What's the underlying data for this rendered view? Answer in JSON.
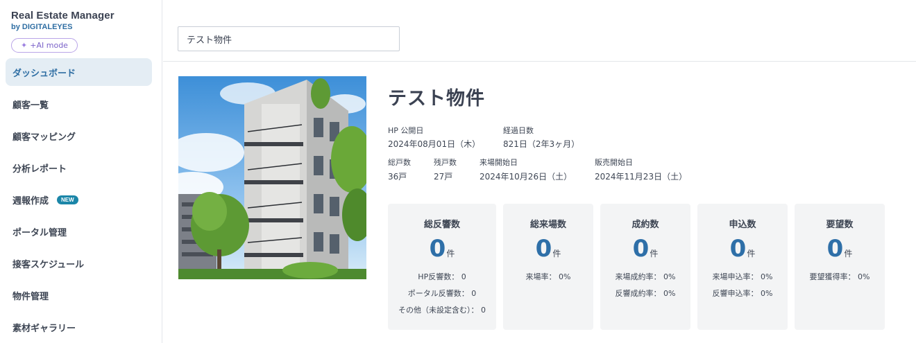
{
  "sidebar": {
    "brand_title": "Real Estate Manager",
    "brand_sub": "by DIGITALEYES",
    "ai_mode": "+AI mode",
    "items": [
      {
        "label": "ダッシュボード",
        "active": true
      },
      {
        "label": "顧客一覧"
      },
      {
        "label": "顧客マッピング"
      },
      {
        "label": "分析レポート"
      },
      {
        "label": "週報作成",
        "badge": "NEW"
      },
      {
        "label": "ポータル管理"
      },
      {
        "label": "接客スケジュール"
      },
      {
        "label": "物件管理"
      },
      {
        "label": "素材ギャラリー"
      }
    ]
  },
  "header": {
    "property_select_value": "テスト物件"
  },
  "property": {
    "title": "テスト物件",
    "hp_published_label": "HP 公開日",
    "hp_published_value": "2024年08月01日（木）",
    "elapsed_label": "経過日数",
    "elapsed_value": "821日（2年3ヶ月）",
    "total_units_label": "総戸数",
    "total_units_value": "36戸",
    "remaining_units_label": "残戸数",
    "remaining_units_value": "27戸",
    "visit_start_label": "来場開始日",
    "visit_start_value": "2024年10月26日（土）",
    "sales_start_label": "販売開始日",
    "sales_start_value": "2024年11月23日（土）"
  },
  "stats": [
    {
      "title": "総反響数",
      "count": "0",
      "unit": "件",
      "lines": [
        "HP反響数： 0",
        "ポータル反響数： 0",
        "その他（未設定含む）： 0"
      ]
    },
    {
      "title": "総来場数",
      "count": "0",
      "unit": "件",
      "lines": [
        "来場率： 0%"
      ]
    },
    {
      "title": "成約数",
      "count": "0",
      "unit": "件",
      "lines": [
        "来場成約率： 0%",
        "反響成約率： 0%"
      ]
    },
    {
      "title": "申込数",
      "count": "0",
      "unit": "件",
      "lines": [
        "来場申込率： 0%",
        "反響申込率： 0%"
      ]
    },
    {
      "title": "要望数",
      "count": "0",
      "unit": "件",
      "lines": [
        "要望獲得率： 0%"
      ]
    }
  ],
  "colors": {
    "accent": "#2e6fa8",
    "active_nav_bg": "#e4edf4",
    "badge": "#1b86a8",
    "card_bg": "#f3f4f5",
    "ai_pill": "#7b62c9"
  },
  "icons": {
    "ai_mode": "sparkle-icon"
  }
}
